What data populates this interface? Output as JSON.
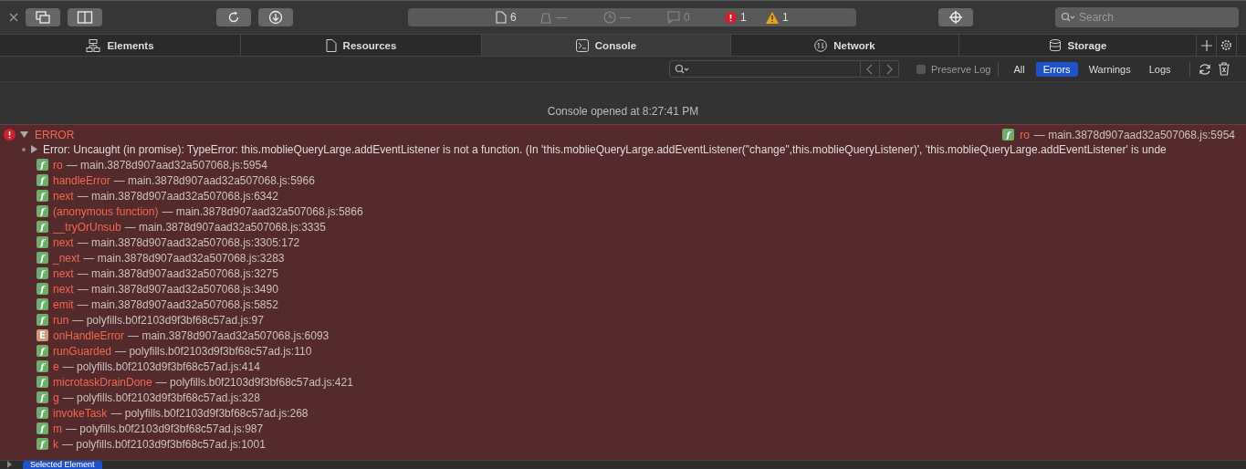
{
  "toolbar": {
    "counts": [
      {
        "kind": "resources",
        "value": "6"
      },
      {
        "kind": "logs",
        "value": "—"
      },
      {
        "kind": "time",
        "value": "—"
      },
      {
        "kind": "messages",
        "value": "0"
      },
      {
        "kind": "errors",
        "value": "1"
      },
      {
        "kind": "warnings",
        "value": "1"
      }
    ],
    "search": {
      "placeholder": "Search"
    }
  },
  "tabs": [
    {
      "label": "Elements",
      "selected": false
    },
    {
      "label": "Resources",
      "selected": false
    },
    {
      "label": "Console",
      "selected": true
    },
    {
      "label": "Network",
      "selected": false
    },
    {
      "label": "Storage",
      "selected": false
    }
  ],
  "filter": {
    "preserve_log": {
      "label": "Preserve Log",
      "checked": false
    },
    "levels": [
      {
        "label": "All",
        "selected": false
      },
      {
        "label": "Errors",
        "selected": true
      },
      {
        "label": "Warnings",
        "selected": false
      },
      {
        "label": "Logs",
        "selected": false
      }
    ]
  },
  "console": {
    "opened_message": "Console opened at 8:27:41 PM",
    "error": {
      "level": "ERROR",
      "expanded": true,
      "source": {
        "kind": "f",
        "name": "ro",
        "location": "— main.3878d907aad32a507068.js:5954"
      },
      "message": "Error: Uncaught (in promise): TypeError: this.moblieQueryLarge.addEventListener is not a function. (In 'this.moblieQueryLarge.addEventListener(\"change\",this.moblieQueryListener)', 'this.moblieQueryLarge.addEventListener' is unde",
      "frames": [
        {
          "kind": "f",
          "name": "ro",
          "location": "— main.3878d907aad32a507068.js:5954"
        },
        {
          "kind": "f",
          "name": "handleError",
          "location": "— main.3878d907aad32a507068.js:5966"
        },
        {
          "kind": "f",
          "name": "next",
          "location": "— main.3878d907aad32a507068.js:6342"
        },
        {
          "kind": "f",
          "name": "(anonymous function)",
          "location": "— main.3878d907aad32a507068.js:5866"
        },
        {
          "kind": "f",
          "name": "__tryOrUnsub",
          "location": "— main.3878d907aad32a507068.js:3335"
        },
        {
          "kind": "f",
          "name": "next",
          "location": "— main.3878d907aad32a507068.js:3305:172"
        },
        {
          "kind": "f",
          "name": "_next",
          "location": "— main.3878d907aad32a507068.js:3283"
        },
        {
          "kind": "f",
          "name": "next",
          "location": "— main.3878d907aad32a507068.js:3275"
        },
        {
          "kind": "f",
          "name": "next",
          "location": "— main.3878d907aad32a507068.js:3490"
        },
        {
          "kind": "f",
          "name": "emit",
          "location": "— main.3878d907aad32a507068.js:5852"
        },
        {
          "kind": "f",
          "name": "run",
          "location": "— polyfills.b0f2103d9f3bf68c57ad.js:97"
        },
        {
          "kind": "E",
          "name": "onHandleError",
          "location": "— main.3878d907aad32a507068.js:6093"
        },
        {
          "kind": "f",
          "name": "runGuarded",
          "location": "— polyfills.b0f2103d9f3bf68c57ad.js:110"
        },
        {
          "kind": "f",
          "name": "e",
          "location": "— polyfills.b0f2103d9f3bf68c57ad.js:414"
        },
        {
          "kind": "f",
          "name": "microtaskDrainDone",
          "location": "— polyfills.b0f2103d9f3bf68c57ad.js:421"
        },
        {
          "kind": "f",
          "name": "g",
          "location": "— polyfills.b0f2103d9f3bf68c57ad.js:328"
        },
        {
          "kind": "f",
          "name": "invokeTask",
          "location": "— polyfills.b0f2103d9f3bf68c57ad.js:268"
        },
        {
          "kind": "f",
          "name": "m",
          "location": "— polyfills.b0f2103d9f3bf68c57ad.js:987"
        },
        {
          "kind": "f",
          "name": "k",
          "location": "— polyfills.b0f2103d9f3bf68c57ad.js:1001"
        }
      ]
    }
  },
  "bottom_bar": {
    "badge": "Selected Element"
  }
}
